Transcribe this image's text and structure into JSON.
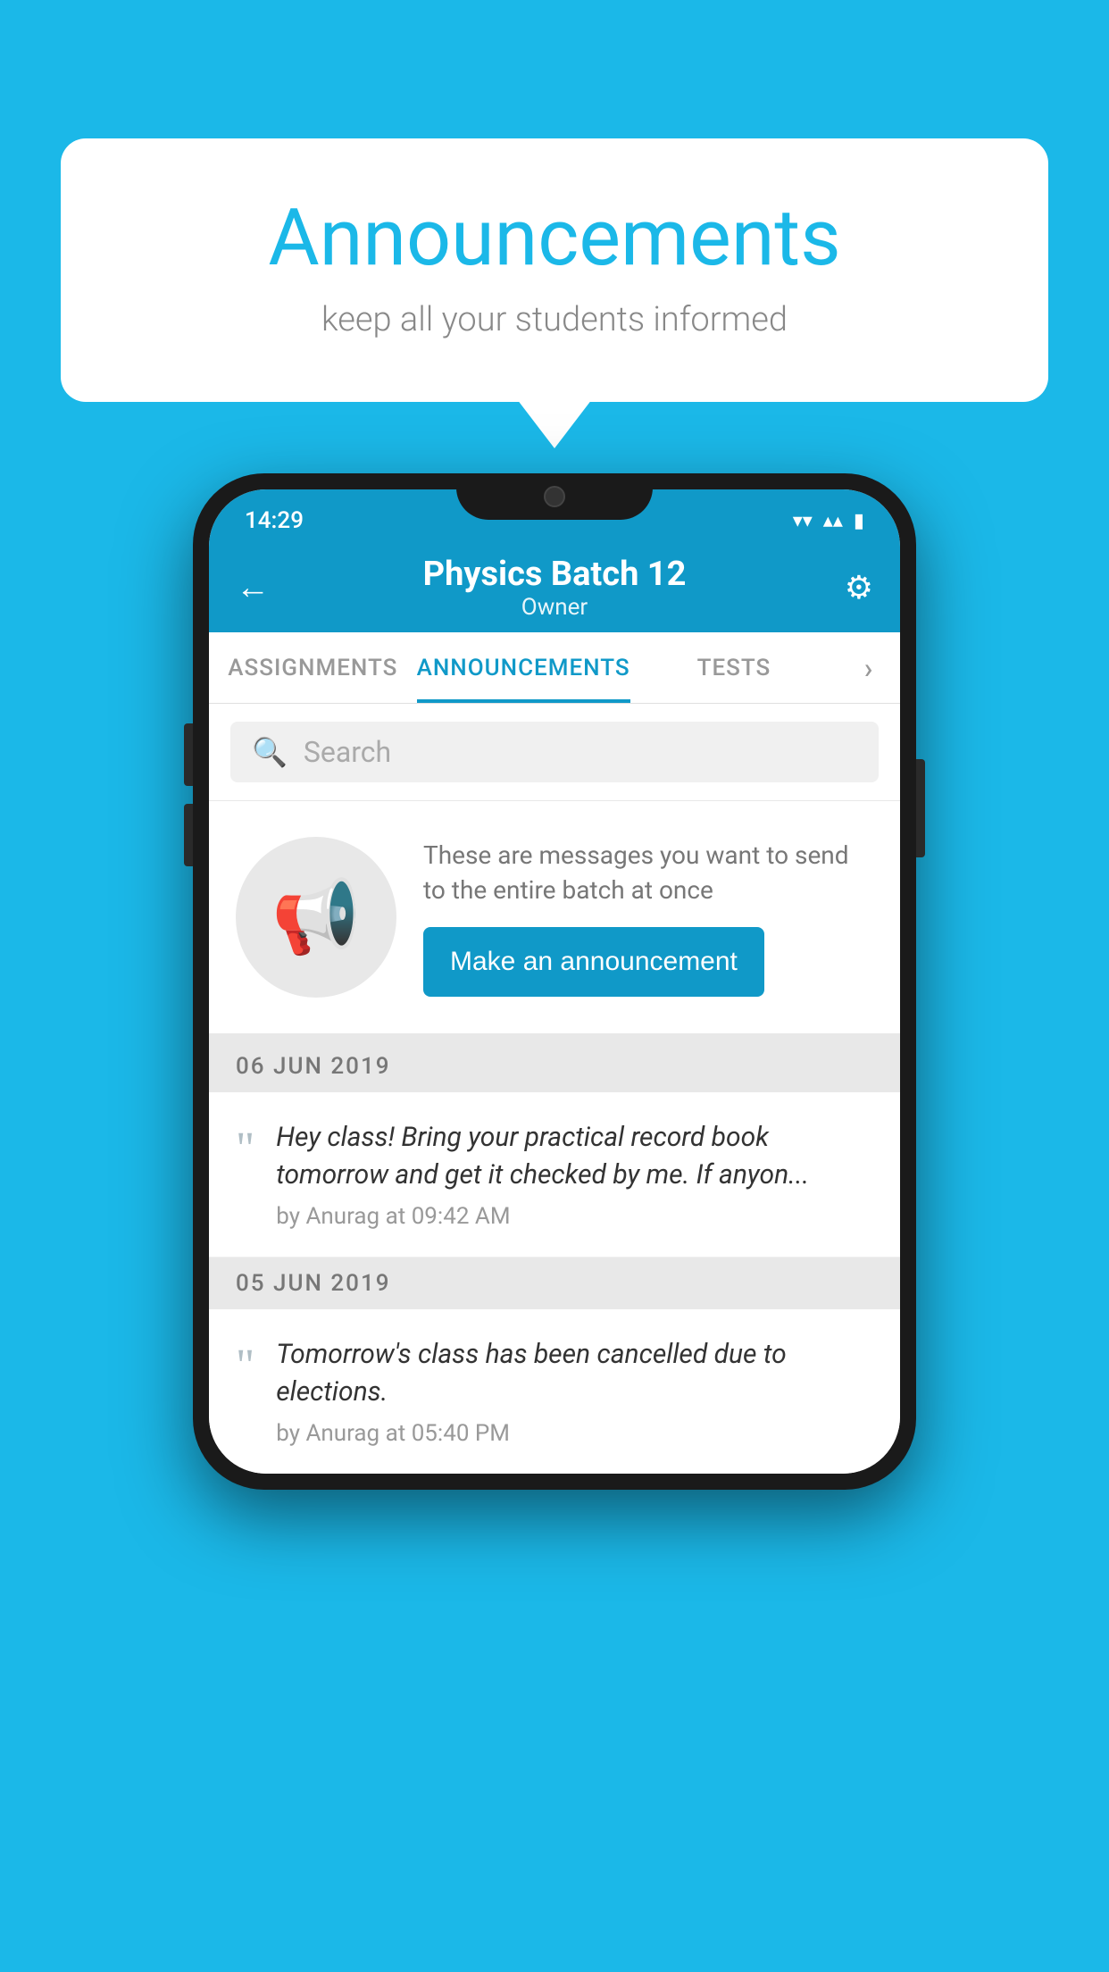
{
  "bubble": {
    "title": "Announcements",
    "subtitle": "keep all your students informed"
  },
  "statusBar": {
    "time": "14:29",
    "wifiIcon": "▾",
    "signalIcon": "▴",
    "batteryIcon": "▮"
  },
  "topBar": {
    "backLabel": "←",
    "title": "Physics Batch 12",
    "subtitle": "Owner",
    "gearIcon": "⚙"
  },
  "tabs": [
    {
      "label": "ASSIGNMENTS",
      "active": false
    },
    {
      "label": "ANNOUNCEMENTS",
      "active": true
    },
    {
      "label": "TESTS",
      "active": false
    },
    {
      "label": "›",
      "active": false
    }
  ],
  "search": {
    "placeholder": "Search"
  },
  "promo": {
    "description": "These are messages you want to send to the entire batch at once",
    "buttonLabel": "Make an announcement"
  },
  "announcements": [
    {
      "date": "06  JUN  2019",
      "text": "Hey class! Bring your practical record book tomorrow and get it checked by me. If anyon...",
      "author": "by Anurag at 09:42 AM"
    },
    {
      "date": "05  JUN  2019",
      "text": "Tomorrow's class has been cancelled due to elections.",
      "author": "by Anurag at 05:40 PM"
    }
  ],
  "colors": {
    "brand": "#1099c8",
    "background": "#1bb8e8"
  }
}
